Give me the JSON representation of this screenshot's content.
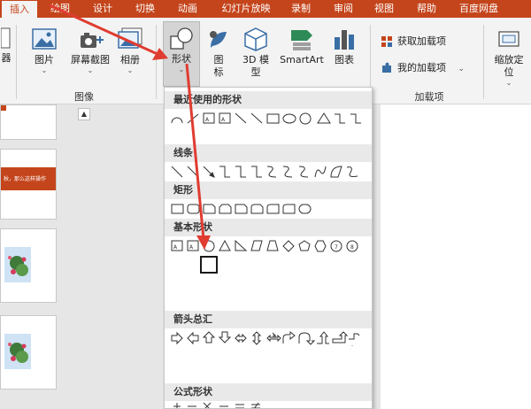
{
  "tabs": [
    {
      "label": "插入",
      "active": true
    },
    {
      "label": "绘图"
    },
    {
      "label": "设计"
    },
    {
      "label": "切换"
    },
    {
      "label": "动画"
    },
    {
      "label": "幻灯片放映"
    },
    {
      "label": "录制"
    },
    {
      "label": "审阅"
    },
    {
      "label": "视图"
    },
    {
      "label": "帮助"
    },
    {
      "label": "百度网盘"
    }
  ],
  "ribbon": {
    "left_partial_label": "器",
    "picture": {
      "label": "图片"
    },
    "screenshot": {
      "label": "屏幕截图"
    },
    "album": {
      "label": "相册"
    },
    "images_group_label": "图像",
    "shapes": {
      "label": "形状"
    },
    "icons": {
      "label": "图",
      "label2": "标"
    },
    "model3d": {
      "label": "3D 模",
      "label2": "型"
    },
    "smartart": {
      "label": "SmartArt"
    },
    "chart": {
      "label": "图表"
    },
    "get_addins": {
      "label": "获取加载项"
    },
    "my_addins": {
      "label": "我的加载项"
    },
    "addins_group_label": "加载项",
    "zoom": {
      "label": "缩放定",
      "label2": "位"
    }
  },
  "dropdown": {
    "sections": [
      {
        "title": "最近使用的形状"
      },
      {
        "title": "线条"
      },
      {
        "title": "矩形"
      },
      {
        "title": "基本形状"
      },
      {
        "title": "箭头总汇"
      },
      {
        "title": "公式形状"
      }
    ],
    "selected_shape": "pie-shape"
  },
  "slides": {
    "thumb_text": "秋，那么这样操作"
  },
  "colors": {
    "accent": "#c4451c",
    "annotation": "#e03c31"
  }
}
